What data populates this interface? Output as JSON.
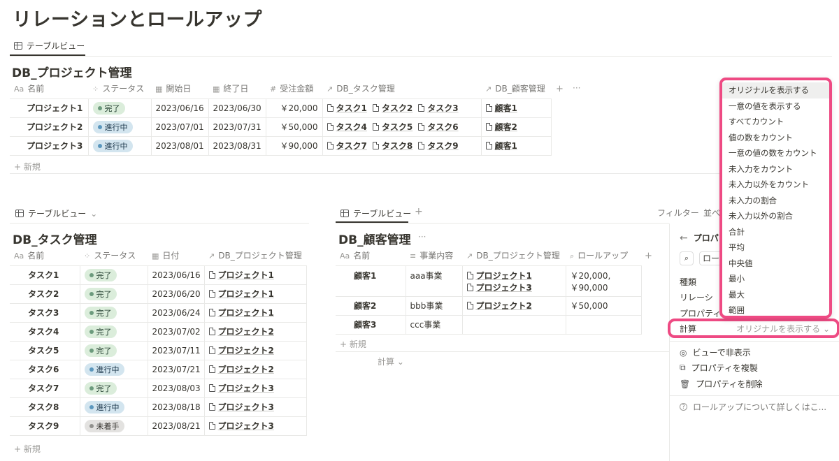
{
  "page_title": "リレーションとロールアップ",
  "top_view_tab": "テーブルビュー",
  "db_project": {
    "title": "DB_プロジェクト管理",
    "headers": [
      {
        "icon": "Aa",
        "label": "名前"
      },
      {
        "icon": "⁘",
        "label": "ステータス"
      },
      {
        "icon": "▦",
        "label": "開始日"
      },
      {
        "icon": "▦",
        "label": "終了日"
      },
      {
        "icon": "#",
        "label": "受注金額"
      },
      {
        "icon": "↗",
        "label": "DB_タスク管理"
      },
      {
        "icon": "↗",
        "label": "DB_顧客管理"
      }
    ],
    "add_col": "+",
    "more": "···",
    "rows": [
      {
        "name": "プロジェクト1",
        "status": "完了",
        "status_kind": "done",
        "start": "2023/06/16",
        "end": "2023/06/30",
        "amount": "￥20,000",
        "tasks": [
          "タスク1",
          "タスク2",
          "タスク3"
        ],
        "customer": "顧客1"
      },
      {
        "name": "プロジェクト2",
        "status": "進行中",
        "status_kind": "prog",
        "start": "2023/07/01",
        "end": "2023/07/31",
        "amount": "￥50,000",
        "tasks": [
          "タスク4",
          "タスク5",
          "タスク6"
        ],
        "customer": "顧客2"
      },
      {
        "name": "プロジェクト3",
        "status": "進行中",
        "status_kind": "prog",
        "start": "2023/08/01",
        "end": "2023/08/31",
        "amount": "￥90,000",
        "tasks": [
          "タスク7",
          "タスク8",
          "タスク9"
        ],
        "customer": "顧客1"
      }
    ],
    "new_label": "+ 新規"
  },
  "task_view_tab": "テーブルビュー",
  "task_view_chevron": "⌄",
  "db_task": {
    "title": "DB_タスク管理",
    "headers": [
      {
        "icon": "Aa",
        "label": "名前"
      },
      {
        "icon": "⁘",
        "label": "ステータス"
      },
      {
        "icon": "▦",
        "label": "日付"
      },
      {
        "icon": "↗",
        "label": "DB_プロジェクト管理"
      }
    ],
    "rows": [
      {
        "name": "タスク1",
        "status": "完了",
        "status_kind": "done",
        "date": "2023/06/16",
        "project": "プロジェクト1"
      },
      {
        "name": "タスク2",
        "status": "完了",
        "status_kind": "done",
        "date": "2023/06/20",
        "project": "プロジェクト1"
      },
      {
        "name": "タスク3",
        "status": "完了",
        "status_kind": "done",
        "date": "2023/06/24",
        "project": "プロジェクト1"
      },
      {
        "name": "タスク4",
        "status": "完了",
        "status_kind": "done",
        "date": "2023/07/02",
        "project": "プロジェクト2"
      },
      {
        "name": "タスク5",
        "status": "完了",
        "status_kind": "done",
        "date": "2023/07/11",
        "project": "プロジェクト2"
      },
      {
        "name": "タスク6",
        "status": "進行中",
        "status_kind": "prog",
        "date": "2023/07/21",
        "project": "プロジェクト2"
      },
      {
        "name": "タスク7",
        "status": "完了",
        "status_kind": "done",
        "date": "2023/08/03",
        "project": "プロジェクト3"
      },
      {
        "name": "タスク8",
        "status": "進行中",
        "status_kind": "prog",
        "date": "2023/08/18",
        "project": "プロジェクト3"
      },
      {
        "name": "タスク9",
        "status": "未着手",
        "status_kind": "todo",
        "date": "2023/08/21",
        "project": "プロジェクト3"
      }
    ],
    "new_label": "+ 新規"
  },
  "customer_view_tab": "テーブルビュー",
  "customer_view_add": "+",
  "filter_label": "フィルター",
  "sort_label_partial": "並べ",
  "db_customer": {
    "title": "DB_顧客管理",
    "more": "···",
    "headers": [
      {
        "icon": "Aa",
        "label": "名前"
      },
      {
        "icon": "≡",
        "label": "事業内容"
      },
      {
        "icon": "↗",
        "label": "DB_プロジェクト管理"
      },
      {
        "icon": "⌕",
        "label": "ロールアップ"
      }
    ],
    "add_col": "+",
    "rows": [
      {
        "name": "顧客1",
        "business": "aaa事業",
        "projects": [
          "プロジェクト1",
          "プロジェクト3"
        ],
        "rollup": [
          "￥20,000,",
          "￥90,000"
        ]
      },
      {
        "name": "顧客2",
        "business": "bbb事業",
        "projects": [
          "プロジェクト2"
        ],
        "rollup": [
          "￥50,000"
        ]
      },
      {
        "name": "顧客3",
        "business": "ccc事業",
        "projects": [],
        "rollup": []
      }
    ],
    "new_label": "+ 新規",
    "calc_label": "計算 ⌄"
  },
  "panel": {
    "back_arrow": "←",
    "title_partial": "プロパ",
    "search_partial": "ロー",
    "type_label": "種類",
    "relation_label": "リレーシ",
    "property_label": "プロパティ",
    "calc_label": "計算",
    "calc_value": "オリジナルを表示する ⌄",
    "hide_label": "ビューで非表示",
    "duplicate_label": "プロパティを複製",
    "delete_label": "プロパティを削除",
    "help_label": "ロールアップについて詳しくはこ..."
  },
  "dropdown_options": [
    "オリジナルを表示する",
    "一意の値を表示する",
    "すべてカウント",
    "値の数をカウント",
    "一意の値の数をカウント",
    "未入力をカウント",
    "未入力以外をカウント",
    "未入力の割合",
    "未入力以外の割合",
    "合計",
    "平均",
    "中央値",
    "最小",
    "最大",
    "範囲"
  ],
  "accent_color": "#ee4a83"
}
